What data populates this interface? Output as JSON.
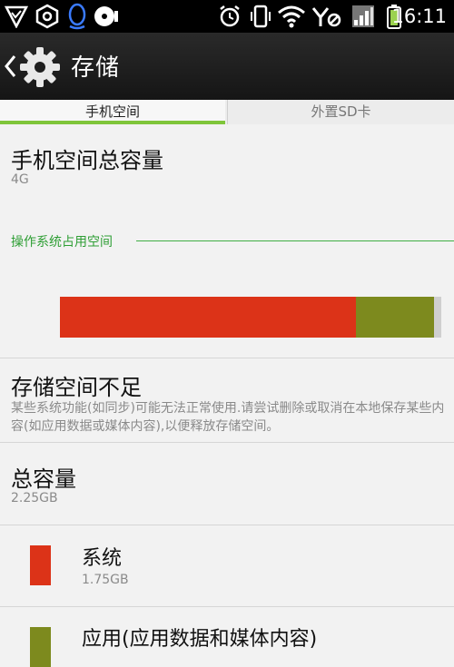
{
  "status_bar": {
    "time": "16:11",
    "left_icons": [
      "shield-check-icon",
      "settings-hex-icon",
      "qq-penguin-icon",
      "media-disc-icon"
    ],
    "right_icons": [
      "alarm-clock-icon",
      "vibrate-icon",
      "wifi-icon",
      "signal-no-sim-icon",
      "cell-signal-icon",
      "battery-icon"
    ],
    "accent_color": "#7fc53a"
  },
  "action_bar": {
    "title": "存储",
    "icons": [
      "back-chevron-icon",
      "gear-icon"
    ]
  },
  "tabs": [
    {
      "label": "手机空间",
      "active": true
    },
    {
      "label": "外置SD卡",
      "active": false
    }
  ],
  "phone_space": {
    "title": "手机空间总容量",
    "value": "4G"
  },
  "os_section": {
    "label": "操作系统占用空间",
    "color": "#2e9e34"
  },
  "storage_bar": {
    "system_fraction": 0.777,
    "apps_fraction": 0.205,
    "free_fraction": 0.018,
    "system_color": "#dc3318",
    "apps_color": "#7d8a1e",
    "free_color": "#cfcfcf"
  },
  "warning": {
    "title": "存储空间不足",
    "description": "某些系统功能(如同步)可能无法正常使用.请尝试删除或取消在本地保存某些内容(如应用数据或媒体内容),以便释放存储空间。"
  },
  "total": {
    "title": "总容量",
    "value": "2.25GB"
  },
  "items": [
    {
      "label": "系统",
      "value": "1.75GB",
      "color": "#dc3318"
    },
    {
      "label": "应用(应用数据和媒体内容)",
      "value": "",
      "color": "#7d8a1e"
    }
  ]
}
